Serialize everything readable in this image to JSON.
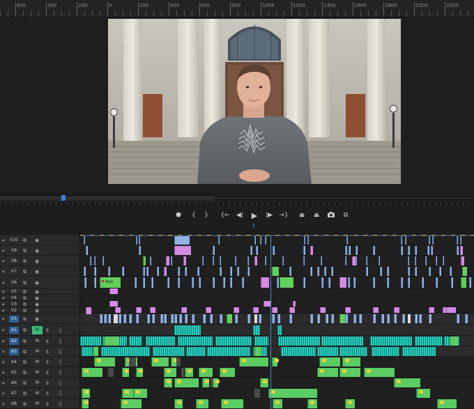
{
  "ruler": {
    "labels": [
      "600",
      "400",
      "200",
      "0",
      "200",
      "400",
      "600",
      "800",
      "1000",
      "1200",
      "1400",
      "1600",
      "1800",
      "2000",
      "2200"
    ]
  },
  "monitor": {
    "scene": "man-standing-in-front-of-columned-building-entrance"
  },
  "scrubber": {
    "playhead_fraction": 0.13
  },
  "transport": {
    "buttons": [
      {
        "name": "add-marker-button",
        "icon": "marker-icon",
        "glyph": "⬟"
      },
      {
        "name": "mark-in-button",
        "icon": "mark-in-icon",
        "glyph": "{"
      },
      {
        "name": "mark-out-button",
        "icon": "mark-out-icon",
        "glyph": "}"
      },
      {
        "name": "go-to-in-button",
        "icon": "go-to-in-icon",
        "glyph": "{←"
      },
      {
        "name": "step-back-button",
        "icon": "step-back-icon",
        "glyph": "◀|"
      },
      {
        "name": "play-button",
        "icon": "play-icon",
        "glyph": "▶"
      },
      {
        "name": "step-forward-button",
        "icon": "step-forward-icon",
        "glyph": "|▶"
      },
      {
        "name": "go-to-out-button",
        "icon": "go-to-out-icon",
        "glyph": "→}"
      },
      {
        "name": "lift-button",
        "icon": "lift-icon",
        "glyph": "⏏"
      },
      {
        "name": "extract-button",
        "icon": "extract-icon",
        "glyph": "⏏"
      },
      {
        "name": "export-frame-button",
        "icon": "camera-icon",
        "glyph": "📷"
      },
      {
        "name": "comparison-view-button",
        "icon": "comparison-icon",
        "glyph": "⧉"
      }
    ],
    "export_glyph": "⇪"
  },
  "timeline": {
    "video_tracks": [
      "V10",
      "V9",
      "V8",
      "V7",
      "V6",
      "V5",
      "V4",
      "V3",
      "V2",
      "V1"
    ],
    "audio_tracks": [
      "A1",
      "A2",
      "A3",
      "A4",
      "A5",
      "A6",
      "A7",
      "A8"
    ],
    "active_track": "V1",
    "active_audio_tracks": [
      "A1",
      "A2",
      "A3"
    ],
    "mute_label": "M",
    "solo_label": "S",
    "solo_on_track": "A1",
    "clip_label_v6": "Nes",
    "colors": {
      "video_blue": "#8fb2e3",
      "pink": "#d38be5",
      "green": "#63cf5b",
      "audio_teal": "#26d3c2",
      "audio_green": "#5bcc63",
      "active_track_blue": "#2f5e92",
      "playhead": "#3f8fe3",
      "solo_green": "#3fb77a"
    },
    "icons": {
      "lock": "lock-icon",
      "sync": "sync-lock-icon",
      "eye": "eye-icon",
      "mic": "microphone-icon"
    }
  }
}
